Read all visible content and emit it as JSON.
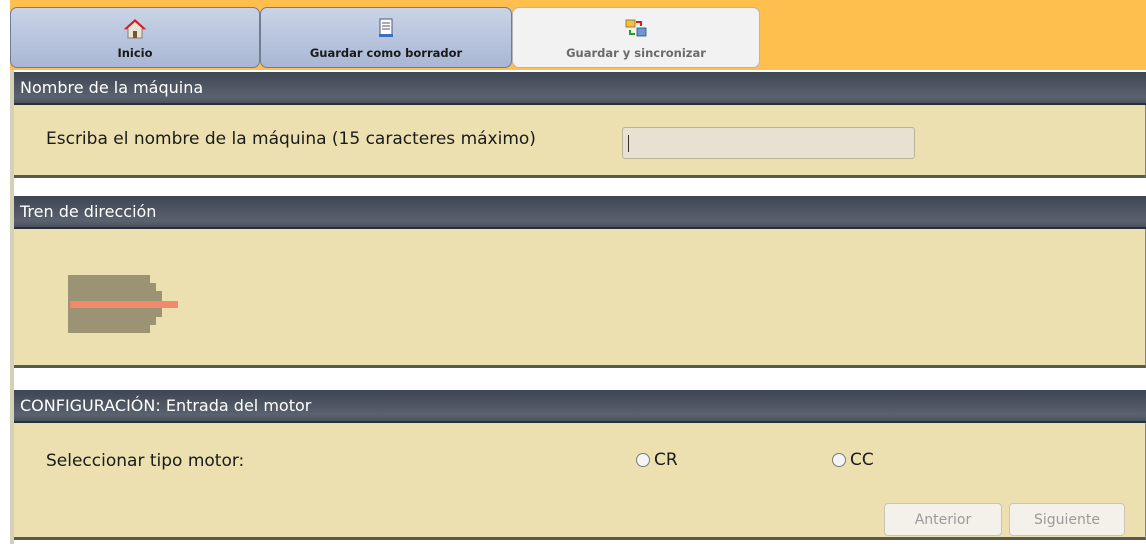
{
  "toolbar": {
    "tabs": [
      {
        "label": "Inicio",
        "icon": "home-icon"
      },
      {
        "label": "Guardar como borrador",
        "icon": "document-icon"
      },
      {
        "label": "Guardar y sincronizar",
        "icon": "sync-icon"
      }
    ]
  },
  "machine_name": {
    "header": "Nombre de la máquina",
    "label": "Escriba el nombre de la máquina (15 caracteres máximo)",
    "value": ""
  },
  "drivetrain": {
    "header": "Tren de dirección",
    "icon": "motor-icon"
  },
  "motor_config": {
    "header": "CONFIGURACIÓN: Entrada del motor",
    "label": "Seleccionar tipo motor:",
    "options": [
      "CR",
      "CC"
    ],
    "selected": null
  },
  "nav": {
    "prev_label": "Anterior",
    "next_label": "Siguiente"
  },
  "colors": {
    "toolbar_bg": "#ffbf4f",
    "panel_bg": "#ece0b0",
    "header_bg": "#4a525d"
  }
}
